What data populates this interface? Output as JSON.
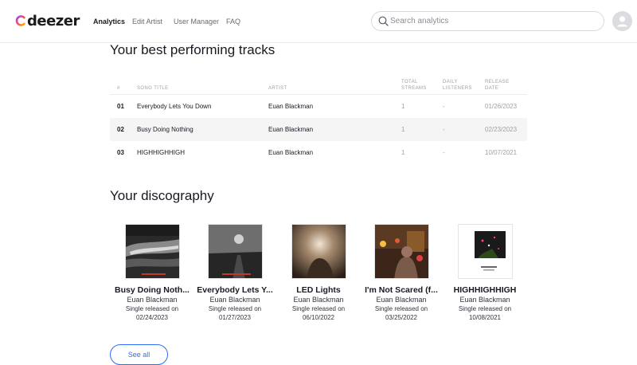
{
  "header": {
    "logo_text": "deezer",
    "nav": [
      "Analytics",
      "Edit Artist",
      "User Manager",
      "FAQ"
    ],
    "search_placeholder": "Search analytics"
  },
  "tracks_section": {
    "title": "Your best performing tracks",
    "columns": [
      "#",
      "SONG TITLE",
      "ARTIST",
      "TOTAL STREAMS",
      "DAILY LISTENERS",
      "RELEASE DATE"
    ],
    "rows": [
      {
        "num": "01",
        "title": "Everybody Lets You Down",
        "artist": "Euan Blackman",
        "streams": "1",
        "daily": "-",
        "date": "01/26/2023"
      },
      {
        "num": "02",
        "title": "Busy Doing Nothing",
        "artist": "Euan Blackman",
        "streams": "1",
        "daily": "-",
        "date": "02/23/2023"
      },
      {
        "num": "03",
        "title": "HIGHHIGHHIGH",
        "artist": "Euan Blackman",
        "streams": "1",
        "daily": "-",
        "date": "10/07/2021"
      }
    ]
  },
  "discography": {
    "title": "Your discography",
    "albums": [
      {
        "title": "Busy Doing Noth...",
        "artist": "Euan Blackman",
        "type": "Single released on",
        "date": "02/24/2023"
      },
      {
        "title": "Everybody Lets Y...",
        "artist": "Euan Blackman",
        "type": "Single released on",
        "date": "01/27/2023"
      },
      {
        "title": "LED Lights",
        "artist": "Euan Blackman",
        "type": "Single released on",
        "date": "06/10/2022"
      },
      {
        "title": "I'm Not Scared (f...",
        "artist": "Euan Blackman",
        "type": "Single released on",
        "date": "03/25/2022"
      },
      {
        "title": "HIGHHIGHHIGH",
        "artist": "Euan Blackman",
        "type": "Single released on",
        "date": "10/08/2021"
      }
    ],
    "see_all_label": "See all"
  }
}
